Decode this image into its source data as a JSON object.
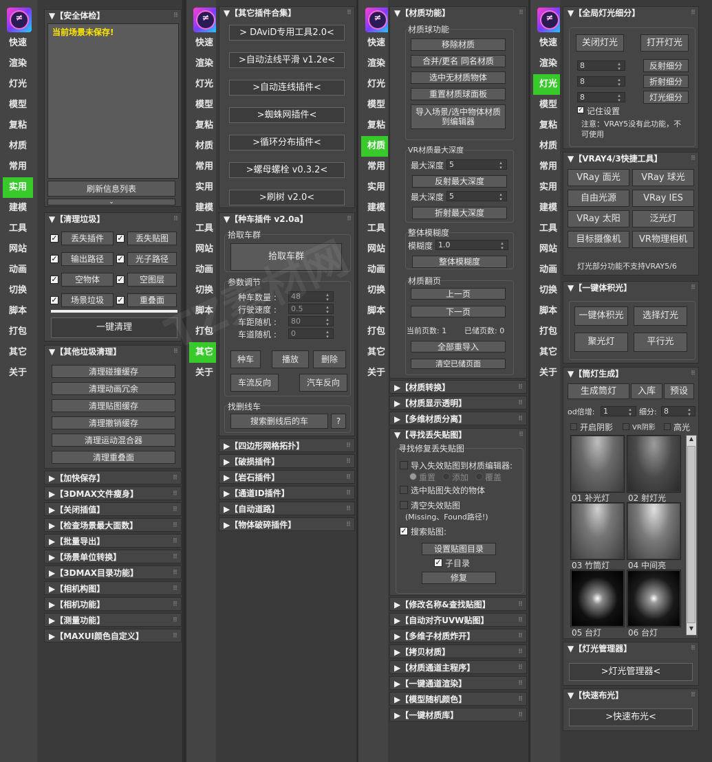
{
  "nav": [
    "快速",
    "渲染",
    "灯光",
    "模型",
    "复粘",
    "材质",
    "常用",
    "实用",
    "建模",
    "工具",
    "网站",
    "动画",
    "切换",
    "脚本",
    "打包",
    "其它",
    "关于"
  ],
  "logo_glyph": "≠",
  "colors": {
    "active_nav": "#38c92a",
    "warn_text": "#ffe600"
  },
  "p1": {
    "safety": {
      "title": "▼【安全体检】",
      "warning": "当前场景未保存!",
      "refresh": "刷新信息列表",
      "chev": "⌄"
    },
    "clean": {
      "title": "▼【清理垃圾】",
      "items": [
        "丢失插件",
        "丢失贴图",
        "输出路径",
        "光子路径",
        "空物体",
        "空图层",
        "场景垃圾",
        "重叠面"
      ],
      "one_click": "一键清理"
    },
    "other": {
      "title": "▼【其他垃圾清理】",
      "items": [
        "清理碰撞缓存",
        "清理动画冗余",
        "清理贴图缓存",
        "清理撤销缓存",
        "清理运动混合器",
        "清理重叠面"
      ]
    },
    "rollouts": [
      "▶【加快保存】",
      "▶【3DMAX文件瘦身】",
      "▶【关闭插值】",
      "▶【检查场景最大面数】",
      "▶【批量导出】",
      "▶【场景单位转换】",
      "▶【3DMAX目录功能】",
      "▶【相机构图】",
      "▶【相机功能】",
      "▶【测量功能】",
      "▶【MAXUI颜色自定义】"
    ]
  },
  "p2": {
    "plugins": {
      "title": "▼【其它插件合集】",
      "items": [
        "> DAviD专用工具2.0<",
        ">自动法线平滑 v1.2e<",
        ">自动连线插件<",
        ">蜘蛛网插件<",
        ">循环分布插件<",
        ">螺母螺栓 v0.3.2<",
        ">刷树 v2.0<"
      ]
    },
    "car": {
      "title": "▼【种车插件 v2.0a】",
      "pick_label": "拾取车群",
      "pick_btn": "拾取车群",
      "params_label": "参数调节",
      "params": [
        {
          "label": "种车数量 :",
          "value": "48"
        },
        {
          "label": "行驶速度 :",
          "value": "0.5"
        },
        {
          "label": "车距随机 :",
          "value": "80"
        },
        {
          "label": "车道随机 :",
          "value": "0"
        }
      ],
      "btns": [
        "种车",
        "播放",
        "删除",
        "车流反向",
        "汽车反向"
      ],
      "search_label": "找删线车",
      "search_btn": "搜索删线后的车",
      "help": "?"
    },
    "rollouts": [
      "▶【四边形网格拓扑】",
      "▶【破损插件】",
      "▶【岩石插件】",
      "▶【通道ID插件】",
      "▶【自动道路】",
      "▶【物体破碎插件】"
    ]
  },
  "p3": {
    "mat": {
      "title": "▼【材质功能】",
      "ball_label": "材质球功能",
      "ball_btns": [
        "移除材质",
        "合并/更名 同名材质",
        "选中无材质物体",
        "重置材质球面板",
        "导入场景/选中物体材质到编辑器"
      ],
      "depth_label": "VR材质最大深度",
      "depth1_label": "最大深度",
      "depth1_value": "5",
      "depth1_btn": "反射最大深度",
      "depth2_label": "最大深度",
      "depth2_value": "5",
      "depth2_btn": "折射最大深度",
      "blur_label": "整体模糊度",
      "blur_field": "模糊度",
      "blur_value": "1.0",
      "blur_btn": "整体模糊度",
      "page_label": "材质翻页",
      "prev": "上一页",
      "next": "下一页",
      "cur_label": "当前页数:",
      "cur_value": "1",
      "total_label": "已储页数:",
      "total_value": "0",
      "import_all": "全部重导入",
      "clear": "清空已储页面"
    },
    "rollouts_a": [
      "▶【材质转换】",
      "▶【材质显示透明】",
      "▶【多维材质分离】"
    ],
    "find": {
      "title": "▼【寻找丢失贴图】",
      "label": "寻找修复丢失贴图",
      "opt1": "导入失效贴图到材质编辑器:",
      "radios": [
        "重置",
        "添加",
        "覆盖"
      ],
      "opt2": "选中贴图失效的物体",
      "opt3": "清空失效贴图",
      "opt3_note": "(Missing、Found路径!)",
      "opt4": "搜索贴图:",
      "set_dir": "设置贴图目录",
      "subdir": "子目录",
      "repair": "修复"
    },
    "rollouts_b": [
      "▶【修改名称&查找贴图】",
      "▶【自动对齐UVW贴图】",
      "▶【多维子材质炸开】",
      "▶【拷贝材质】",
      "▶【材质通道主程序】",
      "▶【一键通道渲染】",
      "▶【模型随机颜色】",
      "▶【一键材质库】"
    ]
  },
  "p4": {
    "subdiv": {
      "title": "▼【全局灯光细分】",
      "off": "关闭灯光",
      "on": "打开灯光",
      "rows": [
        {
          "value": "8",
          "btn": "反射细分"
        },
        {
          "value": "8",
          "btn": "折射细分"
        },
        {
          "value": "8",
          "btn": "灯光细分"
        }
      ],
      "remember": "记住设置",
      "note1": "注意：VRAY5没有此功能，不",
      "note2": "可使用"
    },
    "vray": {
      "title": "▼【VRAY4/3快捷工具】",
      "btns": [
        "VRay 面光",
        "VRay 球光",
        "自由光源",
        "VRay IES",
        "VRay 太阳",
        "泛光灯",
        "目标摄像机",
        "VR物理相机"
      ],
      "note": "灯光部分功能不支持VRAY5/6"
    },
    "bulk": {
      "title": "▼【一键体积光】",
      "btns": [
        "一键体积光",
        "选择灯光",
        "聚光灯",
        "平行光"
      ]
    },
    "ies": {
      "title": "▼【筒灯生成】",
      "gen": "生成筒灯",
      "lib": "入库",
      "preset": "预设",
      "od_label": "od倍增:",
      "od_value": "1",
      "sub_label": "细分:",
      "sub_value": "8",
      "opts": [
        "开启阴影",
        "VR阴影",
        "高光"
      ],
      "thumbs": [
        "01 补光灯",
        "02 射灯光",
        "03 竹筒灯",
        "04 中间亮",
        "05 台灯",
        "06 台灯"
      ]
    },
    "manager": {
      "title": "▼【灯光管理器】",
      "btn": ">灯光管理器<"
    },
    "quick": {
      "title": "▼【快速布光】",
      "btn": ">快速布光<"
    }
  }
}
